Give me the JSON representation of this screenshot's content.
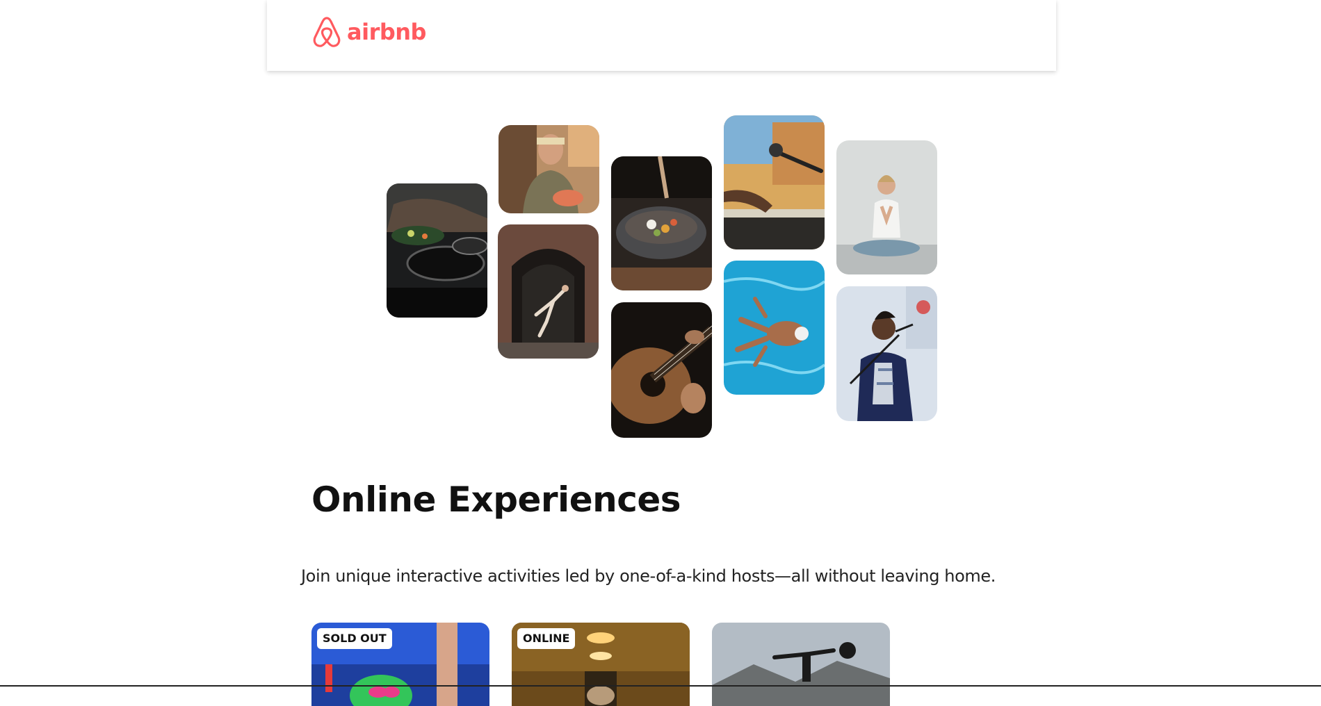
{
  "nav": {
    "logo_text": "airbnb",
    "brand_color": "#FF5A5F"
  },
  "gallery": {
    "tiles": [
      {
        "name": "photo-cooking-pans"
      },
      {
        "name": "photo-woman-holding-tray"
      },
      {
        "name": "photo-dancer-in-doorway"
      },
      {
        "name": "photo-bowl-dish"
      },
      {
        "name": "photo-guitar-player"
      },
      {
        "name": "photo-keyboard-microphone"
      },
      {
        "name": "photo-swimmer-pool"
      },
      {
        "name": "photo-yoga-meditation"
      },
      {
        "name": "photo-singer-microphone"
      }
    ]
  },
  "hero": {
    "title": "Online Experiences",
    "subtitle": "Join unique interactive activities led by one-of-a-kind hosts—all without leaving home."
  },
  "cards": [
    {
      "badge": "SOLD OUT"
    },
    {
      "badge": "ONLINE"
    },
    {
      "badge": ""
    }
  ]
}
